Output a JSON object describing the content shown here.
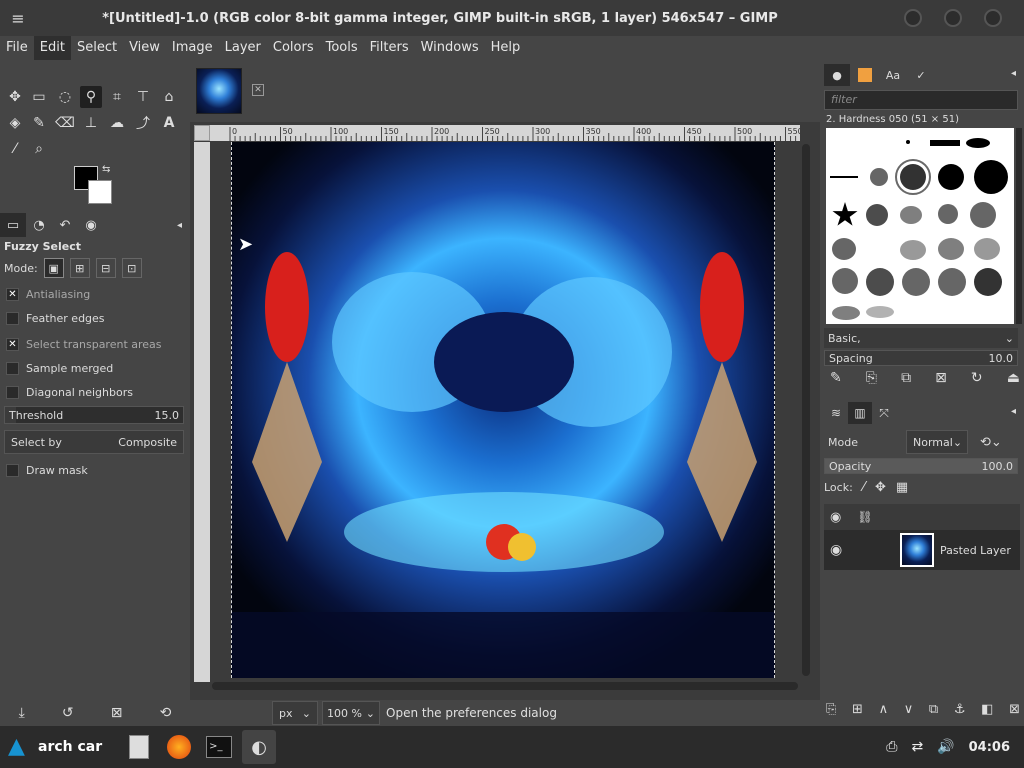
{
  "window": {
    "title": "*[Untitled]-1.0 (RGB color 8-bit gamma integer, GIMP built-in sRGB, 1 layer) 546x547 – GIMP"
  },
  "menu": [
    "File",
    "Edit",
    "Select",
    "View",
    "Image",
    "Layer",
    "Colors",
    "Tools",
    "Filters",
    "Windows",
    "Help"
  ],
  "menu_active": "Edit",
  "tool_options": {
    "title": "Fuzzy Select",
    "mode_label": "Mode:",
    "antialiasing": "Antialiasing",
    "feather": "Feather edges",
    "select_transparent": "Select transparent areas",
    "sample_merged": "Sample merged",
    "diagonal": "Diagonal neighbors",
    "threshold_label": "Threshold",
    "threshold_value": "15.0",
    "threshold_fraction": 0.06,
    "selectby_label": "Select by",
    "selectby_value": "Composite",
    "draw_mask": "Draw mask"
  },
  "ruler": {
    "ticks": [
      "0",
      "50",
      "100",
      "150",
      "200",
      "250",
      "300",
      "350",
      "400",
      "450",
      "500",
      "550"
    ]
  },
  "status": {
    "unit": "px",
    "zoom": "100 %",
    "message": "Open the preferences dialog"
  },
  "brushes": {
    "filter_placeholder": "filter",
    "current": "2. Hardness 050 (51 × 51)",
    "tag": "Basic,",
    "spacing_label": "Spacing",
    "spacing_value": "10.0"
  },
  "layers": {
    "mode_label": "Mode",
    "mode_value": "Normal",
    "opacity_label": "Opacity",
    "opacity_value": "100.0",
    "lock_label": "Lock:",
    "layer_name": "Pasted Layer"
  },
  "taskbar": {
    "start_label": "arch car",
    "clock": "04:06"
  },
  "colors": {
    "fg": "#000000",
    "bg": "#ffffff",
    "accent": "#1793d1"
  }
}
